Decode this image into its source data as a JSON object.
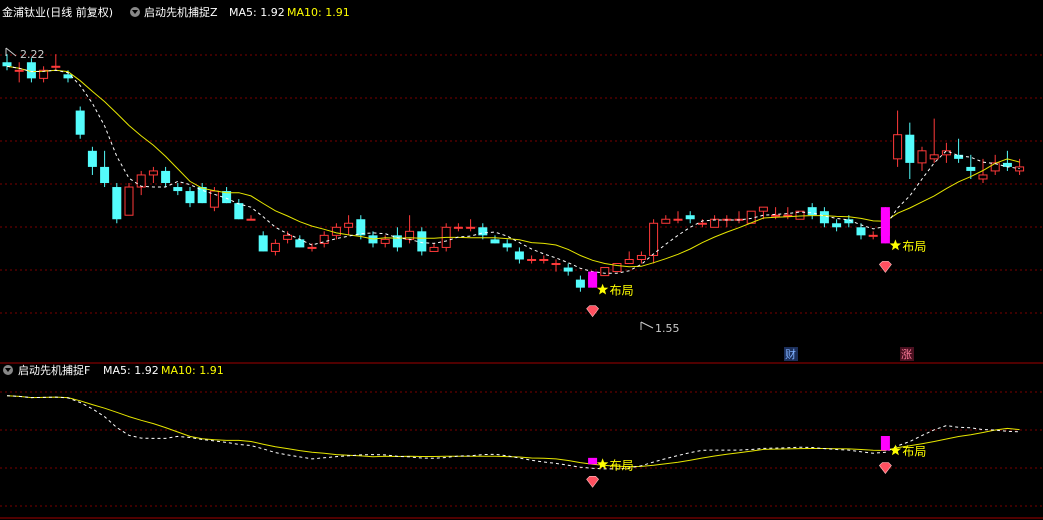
{
  "header_main": {
    "stock": "金浦钛业",
    "period": "(日线 前复权)",
    "indicator": "启动先机捕捉Z",
    "ma5": "MA5: 1.92",
    "ma10": "MA10: 1.91"
  },
  "header_sub": {
    "indicator": "启动先机捕捉F",
    "ma5": "MA5: 1.92",
    "ma10": "MA10: 1.91"
  },
  "annotations": {
    "high_label": "2.22",
    "low_label": "1.55",
    "signal_label": "布局",
    "marker_cai": "财",
    "marker_zhang": "涨"
  },
  "colors": {
    "background": "#000000",
    "up": "#ff3a3a",
    "down": "#54fcfc",
    "ma5": "#ffffff",
    "ma10": "#e6e600",
    "signal_bar": "#ff00ff",
    "signal_text": "#ffff00",
    "grid": "#7a0000",
    "divider": "#a00000",
    "header_white": "#ffffff",
    "header_yellow": "#ffff00"
  },
  "chart_data": {
    "type": "candlestick",
    "price_range": [
      1.48,
      2.27
    ],
    "candles": [
      [
        2.17,
        2.19,
        2.15,
        2.16
      ],
      [
        2.15,
        2.17,
        2.12,
        2.15
      ],
      [
        2.17,
        2.18,
        2.12,
        2.13
      ],
      [
        2.13,
        2.16,
        2.12,
        2.15
      ],
      [
        2.16,
        2.19,
        2.15,
        2.16
      ],
      [
        2.14,
        2.15,
        2.12,
        2.13
      ],
      [
        2.05,
        2.06,
        1.98,
        1.99
      ],
      [
        1.95,
        1.96,
        1.89,
        1.91
      ],
      [
        1.91,
        1.95,
        1.86,
        1.87
      ],
      [
        1.86,
        1.87,
        1.77,
        1.78
      ],
      [
        1.79,
        1.87,
        1.79,
        1.86
      ],
      [
        1.86,
        1.9,
        1.84,
        1.89
      ],
      [
        1.89,
        1.91,
        1.87,
        1.9
      ],
      [
        1.9,
        1.91,
        1.86,
        1.87
      ],
      [
        1.86,
        1.87,
        1.84,
        1.85
      ],
      [
        1.85,
        1.86,
        1.81,
        1.82
      ],
      [
        1.86,
        1.87,
        1.82,
        1.82
      ],
      [
        1.81,
        1.86,
        1.8,
        1.85
      ],
      [
        1.85,
        1.86,
        1.82,
        1.82
      ],
      [
        1.82,
        1.83,
        1.78,
        1.78
      ],
      [
        1.78,
        1.79,
        1.78,
        1.78
      ],
      [
        1.74,
        1.75,
        1.7,
        1.7
      ],
      [
        1.7,
        1.73,
        1.69,
        1.72
      ],
      [
        1.73,
        1.75,
        1.72,
        1.74
      ],
      [
        1.73,
        1.74,
        1.71,
        1.71
      ],
      [
        1.71,
        1.72,
        1.7,
        1.71
      ],
      [
        1.72,
        1.75,
        1.71,
        1.74
      ],
      [
        1.74,
        1.77,
        1.73,
        1.76
      ],
      [
        1.76,
        1.79,
        1.74,
        1.77
      ],
      [
        1.78,
        1.79,
        1.73,
        1.74
      ],
      [
        1.74,
        1.75,
        1.71,
        1.72
      ],
      [
        1.72,
        1.74,
        1.71,
        1.73
      ],
      [
        1.74,
        1.76,
        1.7,
        1.71
      ],
      [
        1.73,
        1.79,
        1.72,
        1.75
      ],
      [
        1.75,
        1.76,
        1.69,
        1.7
      ],
      [
        1.7,
        1.72,
        1.7,
        1.71
      ],
      [
        1.71,
        1.77,
        1.7,
        1.76
      ],
      [
        1.76,
        1.77,
        1.75,
        1.76
      ],
      [
        1.76,
        1.78,
        1.75,
        1.76
      ],
      [
        1.76,
        1.77,
        1.73,
        1.74
      ],
      [
        1.73,
        1.74,
        1.72,
        1.72
      ],
      [
        1.72,
        1.73,
        1.7,
        1.71
      ],
      [
        1.7,
        1.71,
        1.67,
        1.68
      ],
      [
        1.68,
        1.69,
        1.67,
        1.68
      ],
      [
        1.68,
        1.69,
        1.67,
        1.68
      ],
      [
        1.67,
        1.68,
        1.65,
        1.67
      ],
      [
        1.66,
        1.67,
        1.64,
        1.65
      ],
      [
        1.63,
        1.64,
        1.6,
        1.61
      ],
      [
        1.62,
        1.65,
        1.61,
        1.64
      ],
      [
        1.64,
        1.66,
        1.64,
        1.66
      ],
      [
        1.65,
        1.67,
        1.65,
        1.67
      ],
      [
        1.67,
        1.7,
        1.67,
        1.68
      ],
      [
        1.68,
        1.7,
        1.67,
        1.69
      ],
      [
        1.69,
        1.78,
        1.67,
        1.77
      ],
      [
        1.77,
        1.79,
        1.77,
        1.78
      ],
      [
        1.78,
        1.8,
        1.77,
        1.78
      ],
      [
        1.79,
        1.8,
        1.77,
        1.78
      ],
      [
        1.77,
        1.78,
        1.76,
        1.77
      ],
      [
        1.76,
        1.79,
        1.76,
        1.78
      ],
      [
        1.78,
        1.79,
        1.76,
        1.78
      ],
      [
        1.78,
        1.8,
        1.77,
        1.78
      ],
      [
        1.77,
        1.8,
        1.77,
        1.8
      ],
      [
        1.8,
        1.81,
        1.78,
        1.81
      ],
      [
        1.79,
        1.81,
        1.78,
        1.79
      ],
      [
        1.79,
        1.81,
        1.78,
        1.79
      ],
      [
        1.78,
        1.8,
        1.78,
        1.8
      ],
      [
        1.81,
        1.82,
        1.78,
        1.79
      ],
      [
        1.8,
        1.81,
        1.76,
        1.77
      ],
      [
        1.77,
        1.78,
        1.75,
        1.76
      ],
      [
        1.78,
        1.79,
        1.76,
        1.77
      ],
      [
        1.76,
        1.77,
        1.73,
        1.74
      ],
      [
        1.74,
        1.75,
        1.73,
        1.74
      ],
      [
        1.74,
        1.81,
        1.72,
        1.8
      ],
      [
        1.93,
        2.05,
        1.91,
        1.99
      ],
      [
        1.99,
        2.02,
        1.88,
        1.92
      ],
      [
        1.92,
        1.96,
        1.9,
        1.95
      ],
      [
        1.93,
        2.03,
        1.92,
        1.94
      ],
      [
        1.94,
        1.97,
        1.92,
        1.95
      ],
      [
        1.94,
        1.98,
        1.92,
        1.93
      ],
      [
        1.91,
        1.94,
        1.88,
        1.9
      ],
      [
        1.88,
        1.93,
        1.87,
        1.89
      ],
      [
        1.9,
        1.94,
        1.89,
        1.92
      ],
      [
        1.92,
        1.95,
        1.9,
        1.91
      ],
      [
        1.9,
        1.93,
        1.89,
        1.91
      ]
    ],
    "signals": [
      48,
      72
    ],
    "extremes": {
      "high": 2.22,
      "low": 1.55
    }
  }
}
